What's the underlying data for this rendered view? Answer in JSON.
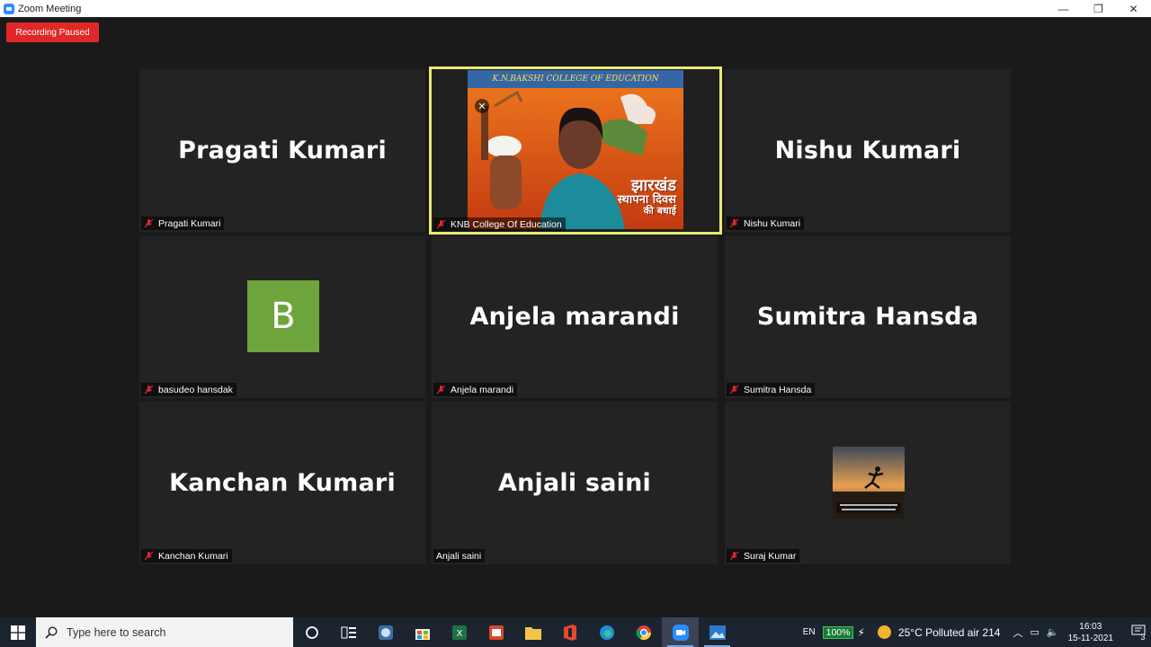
{
  "window": {
    "title": "Zoom Meeting",
    "controls": {
      "minimize": "—",
      "restore": "❐",
      "close": "✕"
    }
  },
  "recording_status": "Recording Paused",
  "participants": [
    {
      "big_name": "Pragati Kumari",
      "label": "Pragati Kumari",
      "muted": true
    },
    {
      "big_name": "",
      "label": "KNB College Of Education",
      "muted": true,
      "active_speaker": true,
      "video": {
        "banner": "K.N.BAKSHI COLLEGE OF EDUCATION",
        "hindi_line1": "झारखंड",
        "hindi_line2": "स्थापना दिवस",
        "hindi_line3": "की बधाई"
      }
    },
    {
      "big_name": "Nishu Kumari",
      "label": "Nishu Kumari",
      "muted": true
    },
    {
      "big_name": "",
      "avatar_letter": "B",
      "label": "basudeo hansdak",
      "muted": true
    },
    {
      "big_name": "Anjela marandi",
      "label": "Anjela marandi",
      "muted": true
    },
    {
      "big_name": "Sumitra Hansda",
      "label": "Sumitra Hansda",
      "muted": true
    },
    {
      "big_name": "Kanchan Kumari",
      "label": "Kanchan Kumari",
      "muted": true
    },
    {
      "big_name": "Anjali saini",
      "label": "Anjali saini",
      "muted": false
    },
    {
      "big_name": "",
      "label": "Suraj Kumar",
      "muted": true
    }
  ],
  "taskbar": {
    "search_placeholder": "Type here to search",
    "language": "EN",
    "battery": "100%",
    "weather": "25°C  Polluted air 214",
    "time": "16:03",
    "date": "15-11-2021",
    "notification_count": "3",
    "colors": {
      "bar": "#1c2430",
      "accent": "#7aa7e0"
    }
  }
}
